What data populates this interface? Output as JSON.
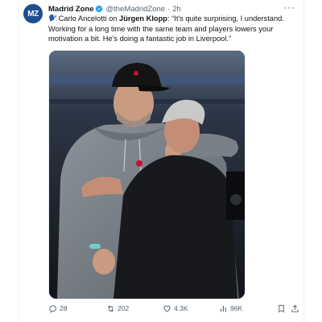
{
  "author": {
    "avatar_text": "MZ",
    "display_name": "Madrid Zone",
    "handle": "@theMadridZone",
    "separator": "·",
    "time_ago": "2h",
    "verified_icon": "verified-badge-icon"
  },
  "tweet": {
    "emoji_icon": "speaking-head-icon",
    "text_prefix": " Carlo Ancelotti on ",
    "text_bold": "Jürgen Klopp",
    "text_rest": ": “It's quite surprising, I understand. Working for a long time with the same team and players lowers your motivation a bit. He's doing a fantastic job in Liverpool.”"
  },
  "media": {
    "alt": "Jürgen Klopp and Carlo Ancelotti embracing"
  },
  "actions": {
    "replies": "28",
    "retweets": "202",
    "likes": "4.3K",
    "views": "96K"
  },
  "colors": {
    "brand_blue": "#1d9bf0",
    "text_secondary": "#536471",
    "avatar_bg": "#1d4f91"
  }
}
